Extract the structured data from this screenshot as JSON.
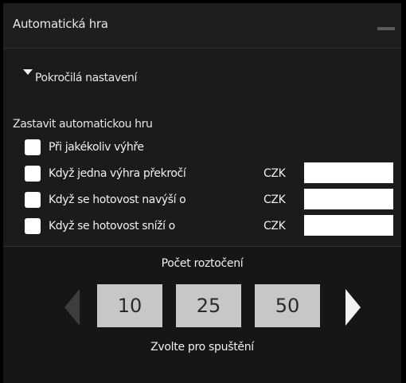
{
  "window": {
    "title": "Automatická hra"
  },
  "advanced": {
    "label": "Pokročilá nastavení"
  },
  "stop": {
    "title": "Zastavit automatickou hru",
    "options": [
      {
        "label": "Při jakékoliv výhře",
        "checked": false
      },
      {
        "label": "Když jedna výhra překročí",
        "checked": false,
        "currency": "CZK",
        "value": ""
      },
      {
        "label": "Když se hotovost navýší o",
        "checked": false,
        "currency": "CZK",
        "value": ""
      },
      {
        "label": "Když se hotovost sníží o",
        "checked": false,
        "currency": "CZK",
        "value": ""
      }
    ]
  },
  "spins": {
    "title": "Počet roztočení",
    "options": [
      "10",
      "25",
      "50"
    ],
    "hint": "Zvolte pro spuštění"
  },
  "colors": {
    "panel_bg": "#1b1b1b",
    "button_bg": "#c7c7c7",
    "arrow_active": "#f2f2f2",
    "arrow_disabled": "#3d3d3d"
  }
}
